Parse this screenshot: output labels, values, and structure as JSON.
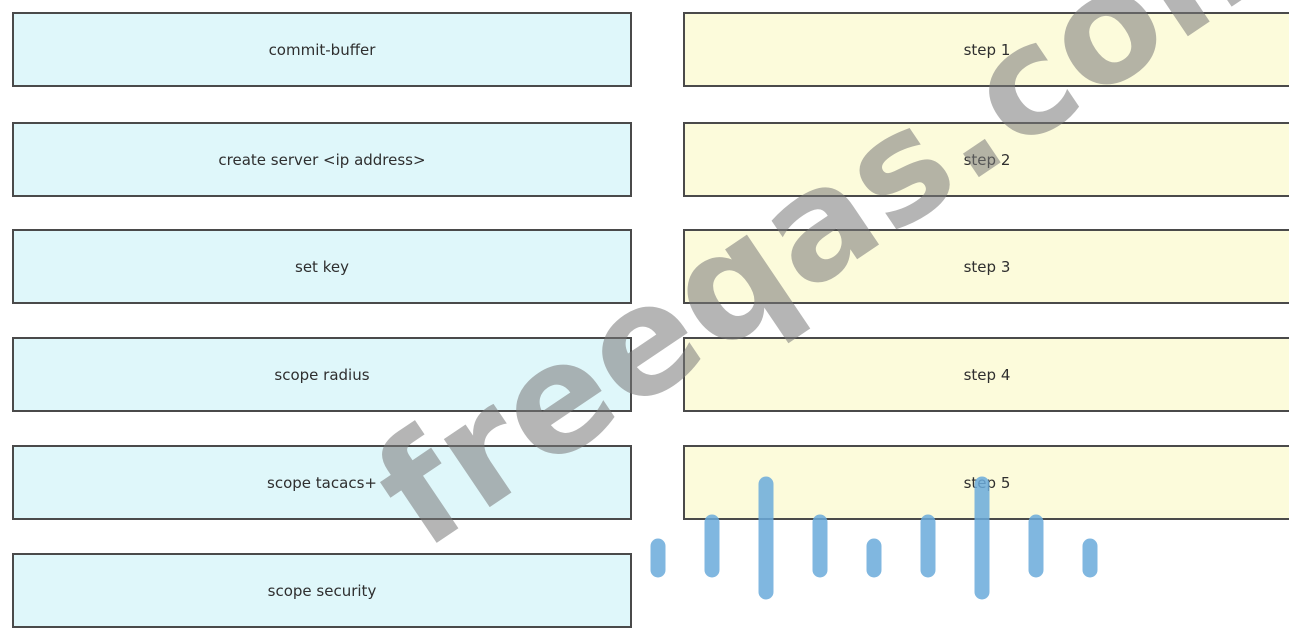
{
  "commands": [
    {
      "label": "commit-buffer"
    },
    {
      "label": "create server <ip address>"
    },
    {
      "label": "set key"
    },
    {
      "label": "scope radius"
    },
    {
      "label": "scope tacacs+"
    },
    {
      "label": "scope security"
    }
  ],
  "steps": [
    {
      "label": "step 1"
    },
    {
      "label": "step 2"
    },
    {
      "label": "step 3"
    },
    {
      "label": "step 4"
    },
    {
      "label": "step 5"
    }
  ],
  "watermark": {
    "text": "freeqas.com",
    "logo_icon": "signal-bars-logo-icon",
    "logo_color": "#6aaadb",
    "text_color": "#787878"
  },
  "colors": {
    "command_bg": "#dff7fa",
    "step_bg": "#fcfbdb",
    "border": "#4a4a4a"
  }
}
